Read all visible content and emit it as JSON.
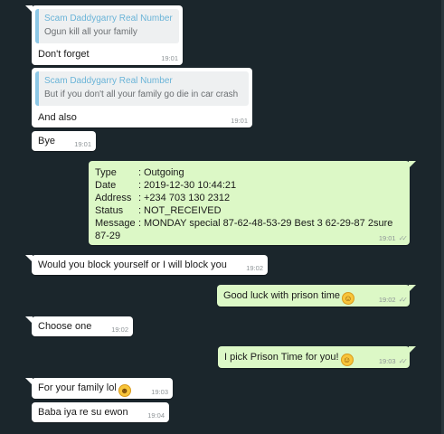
{
  "messages": [
    {
      "quote_author": "Scam Daddygarry Real Number",
      "quote_text": "Ogun kill all your family",
      "text": "Don't forget",
      "time": "19:01"
    },
    {
      "quote_author": "Scam Daddygarry Real Number",
      "quote_text": "But if you don't all your family go die in car crash",
      "text": "And also",
      "time": "19:01"
    },
    {
      "text": "Bye",
      "time": "19:01"
    },
    {
      "details": {
        "type_label": "Type",
        "type_value": "Outgoing",
        "date_label": "Date",
        "date_value": "2019-12-30 10:44:21",
        "address_label": "Address",
        "address_value": "+234 703 130 2312",
        "status_label": "Status",
        "status_value": "NOT_RECEIVED",
        "message_label": "Message",
        "message_value": "MONDAY special 87-62-48-53-29 Best 3 62-29-87 2sure",
        "message_value_cont": "87-29",
        "separator": ":"
      },
      "time": "19:01"
    },
    {
      "text": "Would you block yourself or I will block you",
      "time": "19:02"
    },
    {
      "text": "Good luck with prison time",
      "time": "19:02",
      "emoji": "sweat-smile-emoji"
    },
    {
      "text": "Choose one",
      "time": "19:02"
    },
    {
      "text": "I pick Prison Time for you!",
      "time": "19:03",
      "emoji": "wink-emoji"
    },
    {
      "text": "For your family lol",
      "time": "19:03",
      "emoji": "grin-sweat-emoji"
    },
    {
      "text": "Baba iya re su ewon",
      "time": "19:04"
    }
  ],
  "ticks_glyph": "✓✓",
  "emoji_glyphs": {
    "sweat": "☺",
    "wink": "☺",
    "grin": "☻"
  },
  "colors": {
    "background": "#1b262c",
    "incoming": "#ffffff",
    "outgoing": "#dcf8c6",
    "quote_bar": "#8cc7e6",
    "quote_author": "#6ab4d8"
  }
}
